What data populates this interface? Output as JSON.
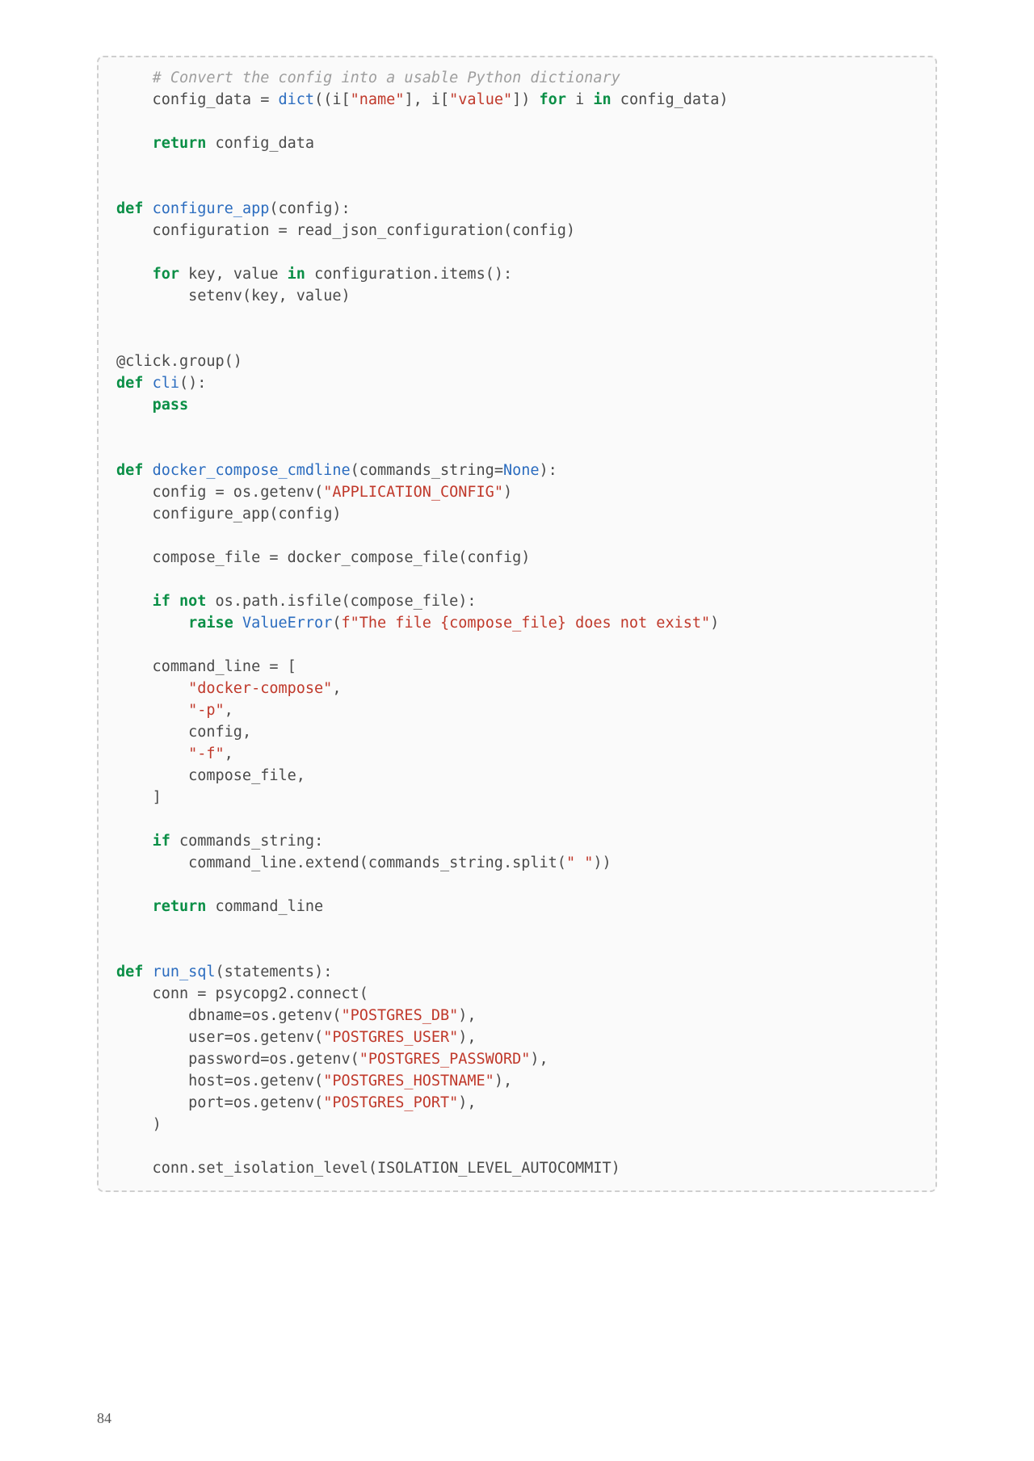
{
  "page_number": "84",
  "code": {
    "tokens": [
      {
        "cls": "",
        "txt": "    "
      },
      {
        "cls": "tok-comment",
        "txt": "# Convert the config into a usable Python dictionary"
      },
      {
        "cls": "",
        "txt": "\n    config_data "
      },
      {
        "cls": "tok-punct",
        "txt": "="
      },
      {
        "cls": "",
        "txt": " "
      },
      {
        "cls": "tok-builtin",
        "txt": "dict"
      },
      {
        "cls": "tok-punct",
        "txt": "(("
      },
      {
        "cls": "tok-name",
        "txt": "i"
      },
      {
        "cls": "tok-punct",
        "txt": "["
      },
      {
        "cls": "tok-string",
        "txt": "\"name\""
      },
      {
        "cls": "tok-punct",
        "txt": "],"
      },
      {
        "cls": "",
        "txt": " i"
      },
      {
        "cls": "tok-punct",
        "txt": "["
      },
      {
        "cls": "tok-string",
        "txt": "\"value\""
      },
      {
        "cls": "tok-punct",
        "txt": "])"
      },
      {
        "cls": "",
        "txt": " "
      },
      {
        "cls": "tok-keyword",
        "txt": "for"
      },
      {
        "cls": "",
        "txt": " i "
      },
      {
        "cls": "tok-keyword",
        "txt": "in"
      },
      {
        "cls": "",
        "txt": " config_data"
      },
      {
        "cls": "tok-punct",
        "txt": ")"
      },
      {
        "cls": "",
        "txt": "\n\n    "
      },
      {
        "cls": "tok-keyword",
        "txt": "return"
      },
      {
        "cls": "",
        "txt": " config_data\n\n\n"
      },
      {
        "cls": "tok-keyword",
        "txt": "def"
      },
      {
        "cls": "",
        "txt": " "
      },
      {
        "cls": "tok-defname",
        "txt": "configure_app"
      },
      {
        "cls": "tok-punct",
        "txt": "("
      },
      {
        "cls": "tok-name",
        "txt": "config"
      },
      {
        "cls": "tok-punct",
        "txt": "):"
      },
      {
        "cls": "",
        "txt": "\n    configuration "
      },
      {
        "cls": "tok-punct",
        "txt": "="
      },
      {
        "cls": "",
        "txt": " read_json_configuration"
      },
      {
        "cls": "tok-punct",
        "txt": "("
      },
      {
        "cls": "tok-name",
        "txt": "config"
      },
      {
        "cls": "tok-punct",
        "txt": ")"
      },
      {
        "cls": "",
        "txt": "\n\n    "
      },
      {
        "cls": "tok-keyword",
        "txt": "for"
      },
      {
        "cls": "",
        "txt": " key"
      },
      {
        "cls": "tok-punct",
        "txt": ","
      },
      {
        "cls": "",
        "txt": " value "
      },
      {
        "cls": "tok-keyword",
        "txt": "in"
      },
      {
        "cls": "",
        "txt": " configuration"
      },
      {
        "cls": "tok-punct",
        "txt": "."
      },
      {
        "cls": "tok-name",
        "txt": "items"
      },
      {
        "cls": "tok-punct",
        "txt": "():"
      },
      {
        "cls": "",
        "txt": "\n        setenv"
      },
      {
        "cls": "tok-punct",
        "txt": "("
      },
      {
        "cls": "tok-name",
        "txt": "key"
      },
      {
        "cls": "tok-punct",
        "txt": ","
      },
      {
        "cls": "",
        "txt": " value"
      },
      {
        "cls": "tok-punct",
        "txt": ")"
      },
      {
        "cls": "",
        "txt": "\n\n\n"
      },
      {
        "cls": "tok-decorator",
        "txt": "@click.group()"
      },
      {
        "cls": "",
        "txt": "\n"
      },
      {
        "cls": "tok-keyword",
        "txt": "def"
      },
      {
        "cls": "",
        "txt": " "
      },
      {
        "cls": "tok-defname",
        "txt": "cli"
      },
      {
        "cls": "tok-punct",
        "txt": "():"
      },
      {
        "cls": "",
        "txt": "\n    "
      },
      {
        "cls": "tok-keyword",
        "txt": "pass"
      },
      {
        "cls": "",
        "txt": "\n\n\n"
      },
      {
        "cls": "tok-keyword",
        "txt": "def"
      },
      {
        "cls": "",
        "txt": " "
      },
      {
        "cls": "tok-defname",
        "txt": "docker_compose_cmdline"
      },
      {
        "cls": "tok-punct",
        "txt": "("
      },
      {
        "cls": "tok-name",
        "txt": "commands_string"
      },
      {
        "cls": "tok-punct",
        "txt": "="
      },
      {
        "cls": "tok-builtin",
        "txt": "None"
      },
      {
        "cls": "tok-punct",
        "txt": "):"
      },
      {
        "cls": "",
        "txt": "\n    config "
      },
      {
        "cls": "tok-punct",
        "txt": "="
      },
      {
        "cls": "",
        "txt": " os"
      },
      {
        "cls": "tok-punct",
        "txt": "."
      },
      {
        "cls": "tok-name",
        "txt": "getenv"
      },
      {
        "cls": "tok-punct",
        "txt": "("
      },
      {
        "cls": "tok-string",
        "txt": "\"APPLICATION_CONFIG\""
      },
      {
        "cls": "tok-punct",
        "txt": ")"
      },
      {
        "cls": "",
        "txt": "\n    configure_app"
      },
      {
        "cls": "tok-punct",
        "txt": "("
      },
      {
        "cls": "tok-name",
        "txt": "config"
      },
      {
        "cls": "tok-punct",
        "txt": ")"
      },
      {
        "cls": "",
        "txt": "\n\n    compose_file "
      },
      {
        "cls": "tok-punct",
        "txt": "="
      },
      {
        "cls": "",
        "txt": " docker_compose_file"
      },
      {
        "cls": "tok-punct",
        "txt": "("
      },
      {
        "cls": "tok-name",
        "txt": "config"
      },
      {
        "cls": "tok-punct",
        "txt": ")"
      },
      {
        "cls": "",
        "txt": "\n\n    "
      },
      {
        "cls": "tok-keyword",
        "txt": "if"
      },
      {
        "cls": "",
        "txt": " "
      },
      {
        "cls": "tok-keyword",
        "txt": "not"
      },
      {
        "cls": "",
        "txt": " os"
      },
      {
        "cls": "tok-punct",
        "txt": "."
      },
      {
        "cls": "tok-name",
        "txt": "path"
      },
      {
        "cls": "tok-punct",
        "txt": "."
      },
      {
        "cls": "tok-name",
        "txt": "isfile"
      },
      {
        "cls": "tok-punct",
        "txt": "("
      },
      {
        "cls": "tok-name",
        "txt": "compose_file"
      },
      {
        "cls": "tok-punct",
        "txt": "):"
      },
      {
        "cls": "",
        "txt": "\n        "
      },
      {
        "cls": "tok-keyword",
        "txt": "raise"
      },
      {
        "cls": "",
        "txt": " "
      },
      {
        "cls": "tok-builtin",
        "txt": "ValueError"
      },
      {
        "cls": "tok-punct",
        "txt": "("
      },
      {
        "cls": "tok-fstring",
        "txt": "f\"The file {compose_file} does not exist\""
      },
      {
        "cls": "tok-punct",
        "txt": ")"
      },
      {
        "cls": "",
        "txt": "\n\n    command_line "
      },
      {
        "cls": "tok-punct",
        "txt": "="
      },
      {
        "cls": "",
        "txt": " "
      },
      {
        "cls": "tok-punct",
        "txt": "["
      },
      {
        "cls": "",
        "txt": "\n        "
      },
      {
        "cls": "tok-string",
        "txt": "\"docker-compose\""
      },
      {
        "cls": "tok-punct",
        "txt": ","
      },
      {
        "cls": "",
        "txt": "\n        "
      },
      {
        "cls": "tok-string",
        "txt": "\"-p\""
      },
      {
        "cls": "tok-punct",
        "txt": ","
      },
      {
        "cls": "",
        "txt": "\n        config"
      },
      {
        "cls": "tok-punct",
        "txt": ","
      },
      {
        "cls": "",
        "txt": "\n        "
      },
      {
        "cls": "tok-string",
        "txt": "\"-f\""
      },
      {
        "cls": "tok-punct",
        "txt": ","
      },
      {
        "cls": "",
        "txt": "\n        compose_file"
      },
      {
        "cls": "tok-punct",
        "txt": ","
      },
      {
        "cls": "",
        "txt": "\n    "
      },
      {
        "cls": "tok-punct",
        "txt": "]"
      },
      {
        "cls": "",
        "txt": "\n\n    "
      },
      {
        "cls": "tok-keyword",
        "txt": "if"
      },
      {
        "cls": "",
        "txt": " commands_string"
      },
      {
        "cls": "tok-punct",
        "txt": ":"
      },
      {
        "cls": "",
        "txt": "\n        command_line"
      },
      {
        "cls": "tok-punct",
        "txt": "."
      },
      {
        "cls": "tok-name",
        "txt": "extend"
      },
      {
        "cls": "tok-punct",
        "txt": "("
      },
      {
        "cls": "tok-name",
        "txt": "commands_string"
      },
      {
        "cls": "tok-punct",
        "txt": "."
      },
      {
        "cls": "tok-name",
        "txt": "split"
      },
      {
        "cls": "tok-punct",
        "txt": "("
      },
      {
        "cls": "tok-string",
        "txt": "\" \""
      },
      {
        "cls": "tok-punct",
        "txt": "))"
      },
      {
        "cls": "",
        "txt": "\n\n    "
      },
      {
        "cls": "tok-keyword",
        "txt": "return"
      },
      {
        "cls": "",
        "txt": " command_line\n\n\n"
      },
      {
        "cls": "tok-keyword",
        "txt": "def"
      },
      {
        "cls": "",
        "txt": " "
      },
      {
        "cls": "tok-defname",
        "txt": "run_sql"
      },
      {
        "cls": "tok-punct",
        "txt": "("
      },
      {
        "cls": "tok-name",
        "txt": "statements"
      },
      {
        "cls": "tok-punct",
        "txt": "):"
      },
      {
        "cls": "",
        "txt": "\n    conn "
      },
      {
        "cls": "tok-punct",
        "txt": "="
      },
      {
        "cls": "",
        "txt": " psycopg2"
      },
      {
        "cls": "tok-punct",
        "txt": "."
      },
      {
        "cls": "tok-name",
        "txt": "connect"
      },
      {
        "cls": "tok-punct",
        "txt": "("
      },
      {
        "cls": "",
        "txt": "\n        dbname"
      },
      {
        "cls": "tok-punct",
        "txt": "="
      },
      {
        "cls": "tok-name",
        "txt": "os"
      },
      {
        "cls": "tok-punct",
        "txt": "."
      },
      {
        "cls": "tok-name",
        "txt": "getenv"
      },
      {
        "cls": "tok-punct",
        "txt": "("
      },
      {
        "cls": "tok-string",
        "txt": "\"POSTGRES_DB\""
      },
      {
        "cls": "tok-punct",
        "txt": "),"
      },
      {
        "cls": "",
        "txt": "\n        user"
      },
      {
        "cls": "tok-punct",
        "txt": "="
      },
      {
        "cls": "tok-name",
        "txt": "os"
      },
      {
        "cls": "tok-punct",
        "txt": "."
      },
      {
        "cls": "tok-name",
        "txt": "getenv"
      },
      {
        "cls": "tok-punct",
        "txt": "("
      },
      {
        "cls": "tok-string",
        "txt": "\"POSTGRES_USER\""
      },
      {
        "cls": "tok-punct",
        "txt": "),"
      },
      {
        "cls": "",
        "txt": "\n        password"
      },
      {
        "cls": "tok-punct",
        "txt": "="
      },
      {
        "cls": "tok-name",
        "txt": "os"
      },
      {
        "cls": "tok-punct",
        "txt": "."
      },
      {
        "cls": "tok-name",
        "txt": "getenv"
      },
      {
        "cls": "tok-punct",
        "txt": "("
      },
      {
        "cls": "tok-string",
        "txt": "\"POSTGRES_PASSWORD\""
      },
      {
        "cls": "tok-punct",
        "txt": "),"
      },
      {
        "cls": "",
        "txt": "\n        host"
      },
      {
        "cls": "tok-punct",
        "txt": "="
      },
      {
        "cls": "tok-name",
        "txt": "os"
      },
      {
        "cls": "tok-punct",
        "txt": "."
      },
      {
        "cls": "tok-name",
        "txt": "getenv"
      },
      {
        "cls": "tok-punct",
        "txt": "("
      },
      {
        "cls": "tok-string",
        "txt": "\"POSTGRES_HOSTNAME\""
      },
      {
        "cls": "tok-punct",
        "txt": "),"
      },
      {
        "cls": "",
        "txt": "\n        port"
      },
      {
        "cls": "tok-punct",
        "txt": "="
      },
      {
        "cls": "tok-name",
        "txt": "os"
      },
      {
        "cls": "tok-punct",
        "txt": "."
      },
      {
        "cls": "tok-name",
        "txt": "getenv"
      },
      {
        "cls": "tok-punct",
        "txt": "("
      },
      {
        "cls": "tok-string",
        "txt": "\"POSTGRES_PORT\""
      },
      {
        "cls": "tok-punct",
        "txt": "),"
      },
      {
        "cls": "",
        "txt": "\n    "
      },
      {
        "cls": "tok-punct",
        "txt": ")"
      },
      {
        "cls": "",
        "txt": "\n\n    conn"
      },
      {
        "cls": "tok-punct",
        "txt": "."
      },
      {
        "cls": "tok-name",
        "txt": "set_isolation_level"
      },
      {
        "cls": "tok-punct",
        "txt": "("
      },
      {
        "cls": "tok-name",
        "txt": "ISOLATION_LEVEL_AUTOCOMMIT"
      },
      {
        "cls": "tok-punct",
        "txt": ")"
      }
    ]
  }
}
